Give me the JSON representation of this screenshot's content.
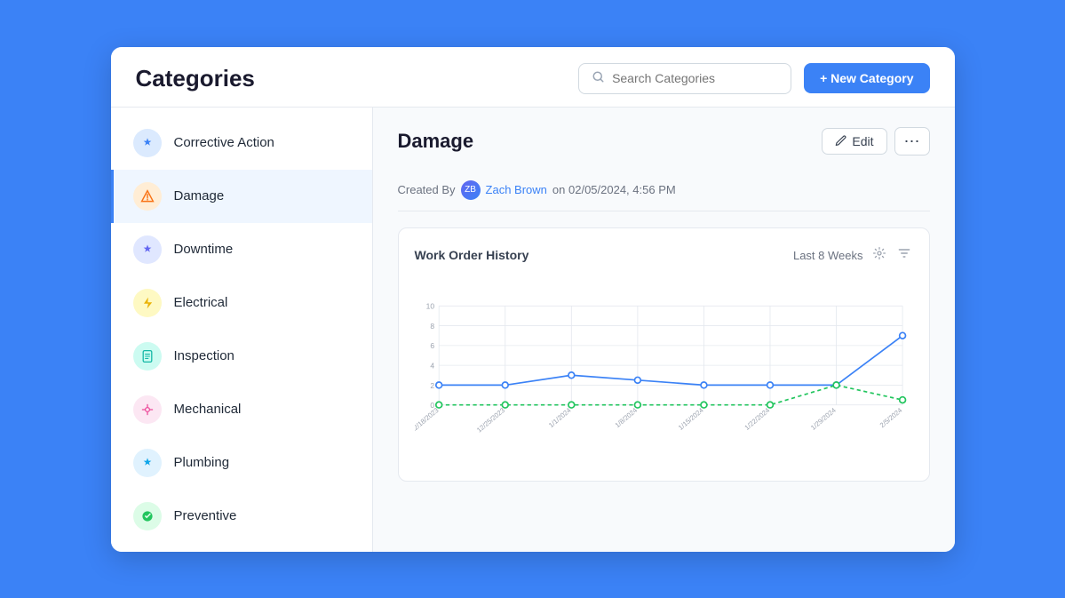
{
  "app": {
    "title": "Categories",
    "search_placeholder": "Search Categories",
    "new_category_label": "+ New Category"
  },
  "sidebar": {
    "items": [
      {
        "id": "corrective-action",
        "label": "Corrective Action",
        "icon": "🏷️",
        "icon_class": "icon-blue"
      },
      {
        "id": "damage",
        "label": "Damage",
        "icon": "⚠️",
        "icon_class": "icon-orange",
        "active": true
      },
      {
        "id": "downtime",
        "label": "Downtime",
        "icon": "🏷️",
        "icon_class": "icon-indigo"
      },
      {
        "id": "electrical",
        "label": "Electrical",
        "icon": "⚡",
        "icon_class": "icon-yellow"
      },
      {
        "id": "inspection",
        "label": "Inspection",
        "icon": "📋",
        "icon_class": "icon-teal"
      },
      {
        "id": "mechanical",
        "label": "Mechanical",
        "icon": "🔧",
        "icon_class": "icon-pink"
      },
      {
        "id": "plumbing",
        "label": "Plumbing",
        "icon": "🏷️",
        "icon_class": "icon-sky"
      },
      {
        "id": "preventive",
        "label": "Preventive",
        "icon": "♻️",
        "icon_class": "icon-green"
      }
    ]
  },
  "detail": {
    "title": "Damage",
    "edit_label": "Edit",
    "created_by_prefix": "Created By",
    "created_by_user": "Zach Brown",
    "created_by_date": "on 02/05/2024, 4:56 PM"
  },
  "chart": {
    "title": "Work Order History",
    "period_label": "Last 8 Weeks",
    "gear_icon": "⚙️",
    "filter_icon": "▼",
    "x_labels": [
      "12/18/2023",
      "12/25/2023",
      "1/1/2024",
      "1/8/2024",
      "1/15/2024",
      "1/22/2024",
      "1/29/2024",
      "2/5/2024"
    ],
    "y_max": 10,
    "y_labels": [
      "0",
      "2",
      "4",
      "6",
      "8",
      "10"
    ],
    "blue_line": [
      2,
      2,
      3,
      2.5,
      2,
      2,
      2,
      7
    ],
    "green_line": [
      0,
      0,
      0,
      0,
      0,
      0,
      2,
      0.5
    ]
  }
}
